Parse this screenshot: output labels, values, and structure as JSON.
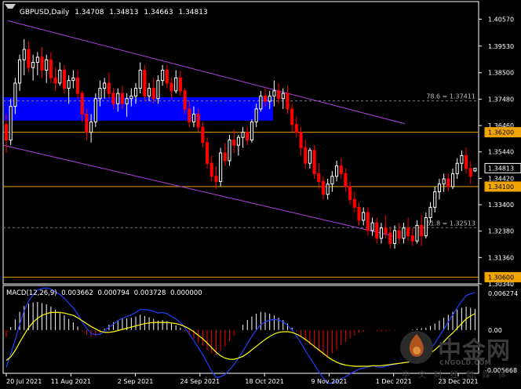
{
  "header": {
    "symbol": "GBPUSD,Daily",
    "open": "1.34708",
    "high": "1.34813",
    "low": "1.34663",
    "close": "1.34813"
  },
  "macd": {
    "label": "MACD(12,26,9)",
    "v1": "0.003662",
    "v2": "0.000794",
    "v3": "0.003728",
    "v4": "0.000000"
  },
  "watermark": {
    "cn": "中金网",
    "en": "CNGOLD.COM",
    "sub": "中文财经新媒体"
  },
  "colors": {
    "background": "#000000",
    "bull_candle": "#ffffff",
    "bear_candle": "#ff0000",
    "channel": "#b040e0",
    "sr_line": "#e8a000",
    "zone": "#0000ff",
    "fib_line": "#7a7a7a",
    "macd_signal": "#ffff00",
    "macd_main": "#2040ff",
    "macd_hist_up": "#ffffff",
    "macd_hist_down": "#ff0000"
  },
  "chart_data": [
    {
      "type": "candlestick",
      "title": "GBPUSD,Daily",
      "x": [
        "20 Jul 2021",
        "11 Aug 2021",
        "2 Sep 2021",
        "24 Sep 2021",
        "18 Oct 2021",
        "9 Nov 2021",
        "1 Dec 2021",
        "23 Dec 2021"
      ],
      "ylim": [
        1.3034,
        1.4125
      ],
      "y_ticks": [
        "1.40570",
        "1.39530",
        "1.38500",
        "1.37480",
        "1.36460",
        "1.35440",
        "1.34420",
        "1.33400",
        "1.32380",
        "1.31360",
        "1.30340"
      ],
      "price_labels": [
        {
          "label": "1.36200",
          "value": 1.362,
          "style": "yellow"
        },
        {
          "label": "1.34813",
          "value": 1.34813,
          "style": "white"
        },
        {
          "label": "1.34100",
          "value": 1.341,
          "style": "yellow"
        },
        {
          "label": "1.30600",
          "value": 1.306,
          "style": "yellow"
        }
      ],
      "horizontal_lines": [
        {
          "value": 1.362,
          "kind": "support-resistance"
        },
        {
          "value": 1.341,
          "kind": "support-resistance"
        },
        {
          "value": 1.306,
          "kind": "support-resistance"
        }
      ],
      "fib_levels": [
        {
          "label": "78.6 = 1.37411",
          "value": 1.37411
        },
        {
          "label": "61.8 = 1.32513",
          "value": 1.32513
        }
      ],
      "zone": {
        "from": 1.3665,
        "to": 1.3755,
        "start": "20 Jul 2021",
        "end": "24 Oct 2021"
      },
      "channel": {
        "upper": [
          {
            "date": "20 Jul 2021",
            "price": 1.4051
          },
          {
            "date": "31 Dec 2021",
            "price": 1.3653
          }
        ],
        "lower": [
          {
            "date": "20 Jul 2021",
            "price": 1.357
          },
          {
            "date": "31 Dec 2021",
            "price": 1.322
          }
        ]
      },
      "candles": [
        [
          1.365,
          1.369,
          1.354,
          1.359
        ],
        [
          1.359,
          1.375,
          1.357,
          1.372
        ],
        [
          1.372,
          1.383,
          1.369,
          1.381
        ],
        [
          1.381,
          1.392,
          1.378,
          1.39
        ],
        [
          1.39,
          1.398,
          1.384,
          1.394
        ],
        [
          1.394,
          1.397,
          1.385,
          1.387
        ],
        [
          1.387,
          1.392,
          1.382,
          1.389
        ],
        [
          1.389,
          1.393,
          1.384,
          1.391
        ],
        [
          1.391,
          1.395,
          1.383,
          1.386
        ],
        [
          1.386,
          1.392,
          1.381,
          1.39
        ],
        [
          1.39,
          1.393,
          1.381,
          1.383
        ],
        [
          1.383,
          1.387,
          1.378,
          1.381
        ],
        [
          1.381,
          1.389,
          1.38,
          1.386
        ],
        [
          1.386,
          1.388,
          1.377,
          1.379
        ],
        [
          1.379,
          1.384,
          1.373,
          1.382
        ],
        [
          1.382,
          1.386,
          1.379,
          1.383
        ],
        [
          1.383,
          1.386,
          1.375,
          1.377
        ],
        [
          1.377,
          1.378,
          1.366,
          1.369
        ],
        [
          1.369,
          1.371,
          1.359,
          1.362
        ],
        [
          1.362,
          1.369,
          1.358,
          1.366
        ],
        [
          1.366,
          1.377,
          1.364,
          1.375
        ],
        [
          1.375,
          1.382,
          1.372,
          1.379
        ],
        [
          1.379,
          1.383,
          1.375,
          1.381
        ],
        [
          1.381,
          1.385,
          1.375,
          1.377
        ],
        [
          1.377,
          1.379,
          1.371,
          1.373
        ],
        [
          1.373,
          1.379,
          1.37,
          1.377
        ],
        [
          1.377,
          1.38,
          1.371,
          1.373
        ],
        [
          1.373,
          1.377,
          1.368,
          1.375
        ],
        [
          1.375,
          1.379,
          1.372,
          1.376
        ],
        [
          1.376,
          1.381,
          1.373,
          1.379
        ],
        [
          1.379,
          1.389,
          1.377,
          1.386
        ],
        [
          1.386,
          1.388,
          1.374,
          1.376
        ],
        [
          1.376,
          1.381,
          1.374,
          1.379
        ],
        [
          1.379,
          1.383,
          1.373,
          1.375
        ],
        [
          1.375,
          1.384,
          1.373,
          1.382
        ],
        [
          1.382,
          1.388,
          1.38,
          1.386
        ],
        [
          1.386,
          1.388,
          1.379,
          1.381
        ],
        [
          1.381,
          1.383,
          1.375,
          1.378
        ],
        [
          1.378,
          1.386,
          1.377,
          1.383
        ],
        [
          1.383,
          1.386,
          1.376,
          1.378
        ],
        [
          1.378,
          1.379,
          1.369,
          1.371
        ],
        [
          1.371,
          1.374,
          1.364,
          1.366
        ],
        [
          1.366,
          1.372,
          1.364,
          1.369
        ],
        [
          1.369,
          1.371,
          1.362,
          1.364
        ],
        [
          1.364,
          1.366,
          1.356,
          1.358
        ],
        [
          1.358,
          1.36,
          1.348,
          1.35
        ],
        [
          1.35,
          1.353,
          1.343,
          1.345
        ],
        [
          1.345,
          1.349,
          1.34,
          1.343
        ],
        [
          1.343,
          1.356,
          1.341,
          1.354
        ],
        [
          1.354,
          1.358,
          1.349,
          1.351
        ],
        [
          1.351,
          1.361,
          1.349,
          1.359
        ],
        [
          1.359,
          1.363,
          1.354,
          1.357
        ],
        [
          1.357,
          1.361,
          1.353,
          1.36
        ],
        [
          1.36,
          1.364,
          1.356,
          1.362
        ],
        [
          1.362,
          1.364,
          1.357,
          1.359
        ],
        [
          1.359,
          1.367,
          1.358,
          1.366
        ],
        [
          1.366,
          1.373,
          1.364,
          1.371
        ],
        [
          1.371,
          1.378,
          1.37,
          1.376
        ],
        [
          1.376,
          1.379,
          1.372,
          1.374
        ],
        [
          1.374,
          1.378,
          1.371,
          1.376
        ],
        [
          1.376,
          1.382,
          1.372,
          1.378
        ],
        [
          1.378,
          1.381,
          1.373,
          1.375
        ],
        [
          1.375,
          1.379,
          1.371,
          1.377
        ],
        [
          1.377,
          1.38,
          1.369,
          1.371
        ],
        [
          1.371,
          1.373,
          1.362,
          1.365
        ],
        [
          1.365,
          1.368,
          1.36,
          1.362
        ],
        [
          1.362,
          1.364,
          1.353,
          1.356
        ],
        [
          1.356,
          1.359,
          1.348,
          1.35
        ],
        [
          1.35,
          1.356,
          1.348,
          1.355
        ],
        [
          1.355,
          1.357,
          1.344,
          1.346
        ],
        [
          1.346,
          1.35,
          1.34,
          1.343
        ],
        [
          1.343,
          1.345,
          1.336,
          1.338
        ],
        [
          1.338,
          1.344,
          1.336,
          1.342
        ],
        [
          1.342,
          1.347,
          1.339,
          1.345
        ],
        [
          1.345,
          1.351,
          1.343,
          1.349
        ],
        [
          1.349,
          1.352,
          1.344,
          1.346
        ],
        [
          1.346,
          1.348,
          1.339,
          1.341
        ],
        [
          1.341,
          1.343,
          1.334,
          1.336
        ],
        [
          1.336,
          1.339,
          1.331,
          1.333
        ],
        [
          1.333,
          1.335,
          1.326,
          1.328
        ],
        [
          1.328,
          1.333,
          1.326,
          1.331
        ],
        [
          1.331,
          1.333,
          1.322,
          1.324
        ],
        [
          1.324,
          1.329,
          1.322,
          1.327
        ],
        [
          1.327,
          1.329,
          1.319,
          1.321
        ],
        [
          1.321,
          1.327,
          1.319,
          1.325
        ],
        [
          1.325,
          1.33,
          1.321,
          1.323
        ],
        [
          1.323,
          1.325,
          1.317,
          1.319
        ],
        [
          1.319,
          1.326,
          1.317,
          1.324
        ],
        [
          1.324,
          1.327,
          1.319,
          1.321
        ],
        [
          1.321,
          1.327,
          1.319,
          1.325
        ],
        [
          1.325,
          1.329,
          1.32,
          1.322
        ],
        [
          1.322,
          1.325,
          1.318,
          1.32
        ],
        [
          1.32,
          1.328,
          1.319,
          1.326
        ],
        [
          1.326,
          1.33,
          1.318,
          1.322
        ],
        [
          1.322,
          1.331,
          1.321,
          1.329
        ],
        [
          1.329,
          1.335,
          1.327,
          1.333
        ],
        [
          1.333,
          1.341,
          1.331,
          1.339
        ],
        [
          1.339,
          1.344,
          1.336,
          1.342
        ],
        [
          1.342,
          1.346,
          1.339,
          1.344
        ],
        [
          1.344,
          1.346,
          1.339,
          1.341
        ],
        [
          1.341,
          1.348,
          1.34,
          1.346
        ],
        [
          1.346,
          1.352,
          1.344,
          1.35
        ],
        [
          1.35,
          1.355,
          1.347,
          1.353
        ],
        [
          1.353,
          1.356,
          1.346,
          1.348
        ],
        [
          1.348,
          1.351,
          1.342,
          1.345
        ],
        [
          1.34708,
          1.34813,
          1.34663,
          1.34813
        ]
      ]
    },
    {
      "type": "bar",
      "title": "MACD(12,26,9)",
      "ylim": [
        -0.0066,
        0.006274
      ],
      "y_ticks": [
        "0.006274",
        "0.00",
        "-0.005668"
      ],
      "histogram": [
        -0.0012,
        0.0005,
        0.0018,
        0.0031,
        0.0041,
        0.0045,
        0.0047,
        0.0048,
        0.0046,
        0.0044,
        0.004,
        0.0035,
        0.0031,
        0.0025,
        0.0019,
        0.0013,
        0.0006,
        -0.0002,
        -0.0008,
        -0.0012,
        -0.001,
        -0.0005,
        0.0002,
        0.0009,
        0.0013,
        0.0017,
        0.0019,
        0.002,
        0.0021,
        0.0023,
        0.0026,
        0.0024,
        0.0022,
        0.0019,
        0.0016,
        0.0017,
        0.0015,
        0.0011,
        0.0008,
        0.0004,
        -0.0002,
        -0.0009,
        -0.0015,
        -0.0021,
        -0.0027,
        -0.0034,
        -0.004,
        -0.0043,
        -0.0036,
        -0.0028,
        -0.0018,
        -0.0009,
        0.0,
        0.0009,
        0.0017,
        0.0023,
        0.0028,
        0.0031,
        0.003,
        0.0028,
        0.0025,
        0.0021,
        0.0017,
        0.0011,
        0.0004,
        -0.0003,
        -0.0011,
        -0.0019,
        -0.0025,
        -0.0031,
        -0.0037,
        -0.0042,
        -0.0045,
        -0.004,
        -0.0033,
        -0.0026,
        -0.002,
        -0.0014,
        -0.0009,
        -0.0005,
        -0.0003,
        -0.0001,
        0.0,
        -0.0002,
        -0.0003,
        -0.0002,
        -0.0001,
        -0.0001,
        0.0,
        0.0,
        0.0,
        0.0001,
        0.0002,
        0.0003,
        0.0004,
        0.0007,
        0.0011,
        0.0016,
        0.0021,
        0.0026,
        0.0031,
        0.0035,
        0.0038,
        0.004,
        0.0038,
        0.0036
      ],
      "signal": [
        -0.0052,
        -0.0046,
        -0.0035,
        -0.0021,
        -0.0008,
        0.0004,
        0.0013,
        0.002,
        0.0025,
        0.0028,
        0.003,
        0.003,
        0.003,
        0.0029,
        0.0027,
        0.0025,
        0.0021,
        0.0016,
        0.0011,
        0.0006,
        0.0002,
        -0.0002,
        -0.0004,
        -0.0004,
        -0.0003,
        -0.0001,
        0.0001,
        0.0003,
        0.0005,
        0.0007,
        0.0009,
        0.0011,
        0.0012,
        0.0013,
        0.0013,
        0.0013,
        0.0013,
        0.0012,
        0.0011,
        0.0009,
        0.0006,
        0.0002,
        -0.0003,
        -0.0009,
        -0.0015,
        -0.0022,
        -0.003,
        -0.0038,
        -0.0044,
        -0.0048,
        -0.005,
        -0.005,
        -0.0048,
        -0.0045,
        -0.004,
        -0.0034,
        -0.0028,
        -0.0022,
        -0.0016,
        -0.0011,
        -0.0007,
        -0.0004,
        -0.0003,
        -0.0003,
        -0.0004,
        -0.0007,
        -0.0011,
        -0.0016,
        -0.0022,
        -0.0028,
        -0.0034,
        -0.004,
        -0.0046,
        -0.0051,
        -0.0055,
        -0.0058,
        -0.006,
        -0.0061,
        -0.0062,
        -0.0062,
        -0.0062,
        -0.0062,
        -0.0061,
        -0.0061,
        -0.0061,
        -0.006,
        -0.0059,
        -0.0058,
        -0.0057,
        -0.0056,
        -0.0055,
        -0.0053,
        -0.0051,
        -0.0048,
        -0.0044,
        -0.004,
        -0.0034,
        -0.0027,
        -0.002,
        -0.0012,
        -0.0005,
        0.0003,
        0.0011,
        0.0019,
        0.0024,
        0.0028
      ],
      "main": [
        -0.0064,
        -0.0041,
        -0.0017,
        0.001,
        0.0033,
        0.0049,
        0.006,
        0.0068,
        0.0071,
        0.0072,
        0.007,
        0.0065,
        0.0061,
        0.0054,
        0.0046,
        0.0038,
        0.0027,
        0.0014,
        0.0003,
        -0.0006,
        -0.0008,
        -0.0007,
        -0.0002,
        0.0005,
        0.001,
        0.0016,
        0.002,
        0.0023,
        0.0026,
        0.003,
        0.0035,
        0.0035,
        0.0034,
        0.0032,
        0.0029,
        0.003,
        0.0028,
        0.0023,
        0.0019,
        0.0013,
        0.0004,
        -0.0007,
        -0.0018,
        -0.003,
        -0.0042,
        -0.0056,
        -0.007,
        -0.0081,
        -0.008,
        -0.0076,
        -0.0068,
        -0.0059,
        -0.0048,
        -0.0036,
        -0.0023,
        -0.0011,
        0.0,
        0.0009,
        0.0014,
        0.0017,
        0.0018,
        0.0017,
        0.0014,
        0.0008,
        0.0,
        -0.001,
        -0.0022,
        -0.0035,
        -0.0047,
        -0.0059,
        -0.0071,
        -0.0082,
        -0.0091,
        -0.0091,
        -0.0088,
        -0.0084,
        -0.008,
        -0.0075,
        -0.0071,
        -0.0067,
        -0.0065,
        -0.0063,
        -0.0061,
        -0.0063,
        -0.0064,
        -0.0062,
        -0.006,
        -0.0059,
        -0.0057,
        -0.0056,
        -0.0055,
        -0.0052,
        -0.0049,
        -0.0045,
        -0.004,
        -0.0033,
        -0.0023,
        -0.0011,
        0.0001,
        0.0014,
        0.0026,
        0.0038,
        0.0049,
        0.0059,
        0.0062,
        0.0064
      ]
    }
  ]
}
